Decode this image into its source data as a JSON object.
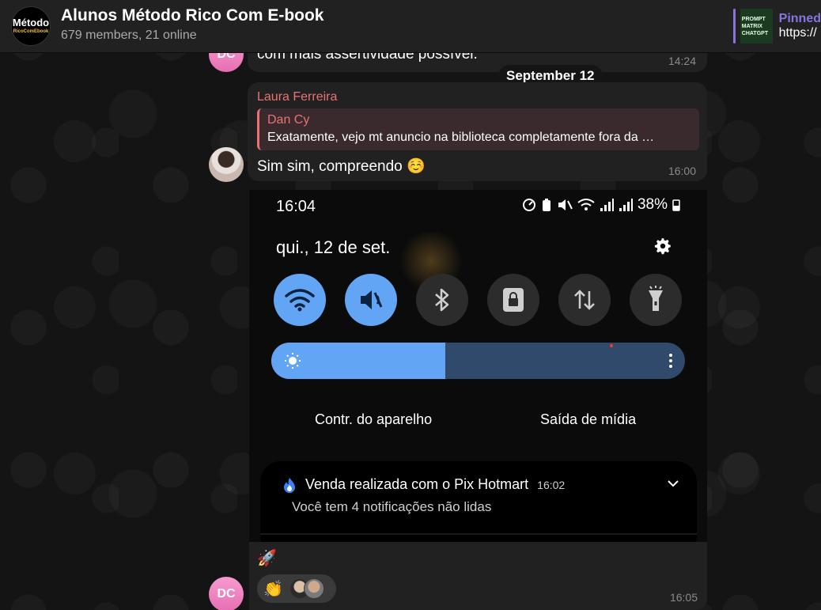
{
  "header": {
    "avatar_line1": "Método",
    "avatar_line2": "RicoComEbook",
    "title": "Alunos Método Rico Com E-book",
    "subtitle": "679 members, 21 online",
    "pinned_label": "Pinned",
    "pinned_link": "https://",
    "pinned_thumb_lines": [
      "PROMPT",
      "MATRIX",
      "CHATGPT"
    ]
  },
  "messages": {
    "first": {
      "avatar_initials": "DC",
      "text": "com mais assertividade possível.",
      "time": "14:24"
    },
    "date_separator": "September 12",
    "laura": {
      "sender": "Laura Ferreira",
      "reply_name": "Dan Cy",
      "reply_text": "Exatamente, vejo mt anuncio na biblioteca completamente fora da …",
      "text": "Sim sim, compreendo ☺️",
      "time": "16:00"
    },
    "last": {
      "avatar_initials": "DC",
      "rocket": "🚀",
      "reaction_emoji": "👏",
      "time": "16:05"
    }
  },
  "phone": {
    "time": "16:04",
    "battery": "38%",
    "date": "qui., 12 de set.",
    "brightness_level": 0.42,
    "device_control": "Contr. do aparelho",
    "media_output": "Saída de mídia",
    "notification": {
      "title": "Venda realizada com o Pix Hotmart",
      "time": "16:02",
      "subtitle": "Você tem 4 notificações não lidas"
    },
    "quick_settings": [
      {
        "icon": "wifi-icon",
        "on": true
      },
      {
        "icon": "mute-icon",
        "on": true
      },
      {
        "icon": "bluetooth-icon",
        "on": false
      },
      {
        "icon": "lock-rotation-icon",
        "on": false
      },
      {
        "icon": "data-transfer-icon",
        "on": false
      },
      {
        "icon": "flashlight-icon",
        "on": false
      }
    ]
  },
  "colors": {
    "accent": "#8774e1",
    "sender": "#ea7272",
    "qs_on": "#62a5f5",
    "avatar_pink": "#f79ad0"
  }
}
